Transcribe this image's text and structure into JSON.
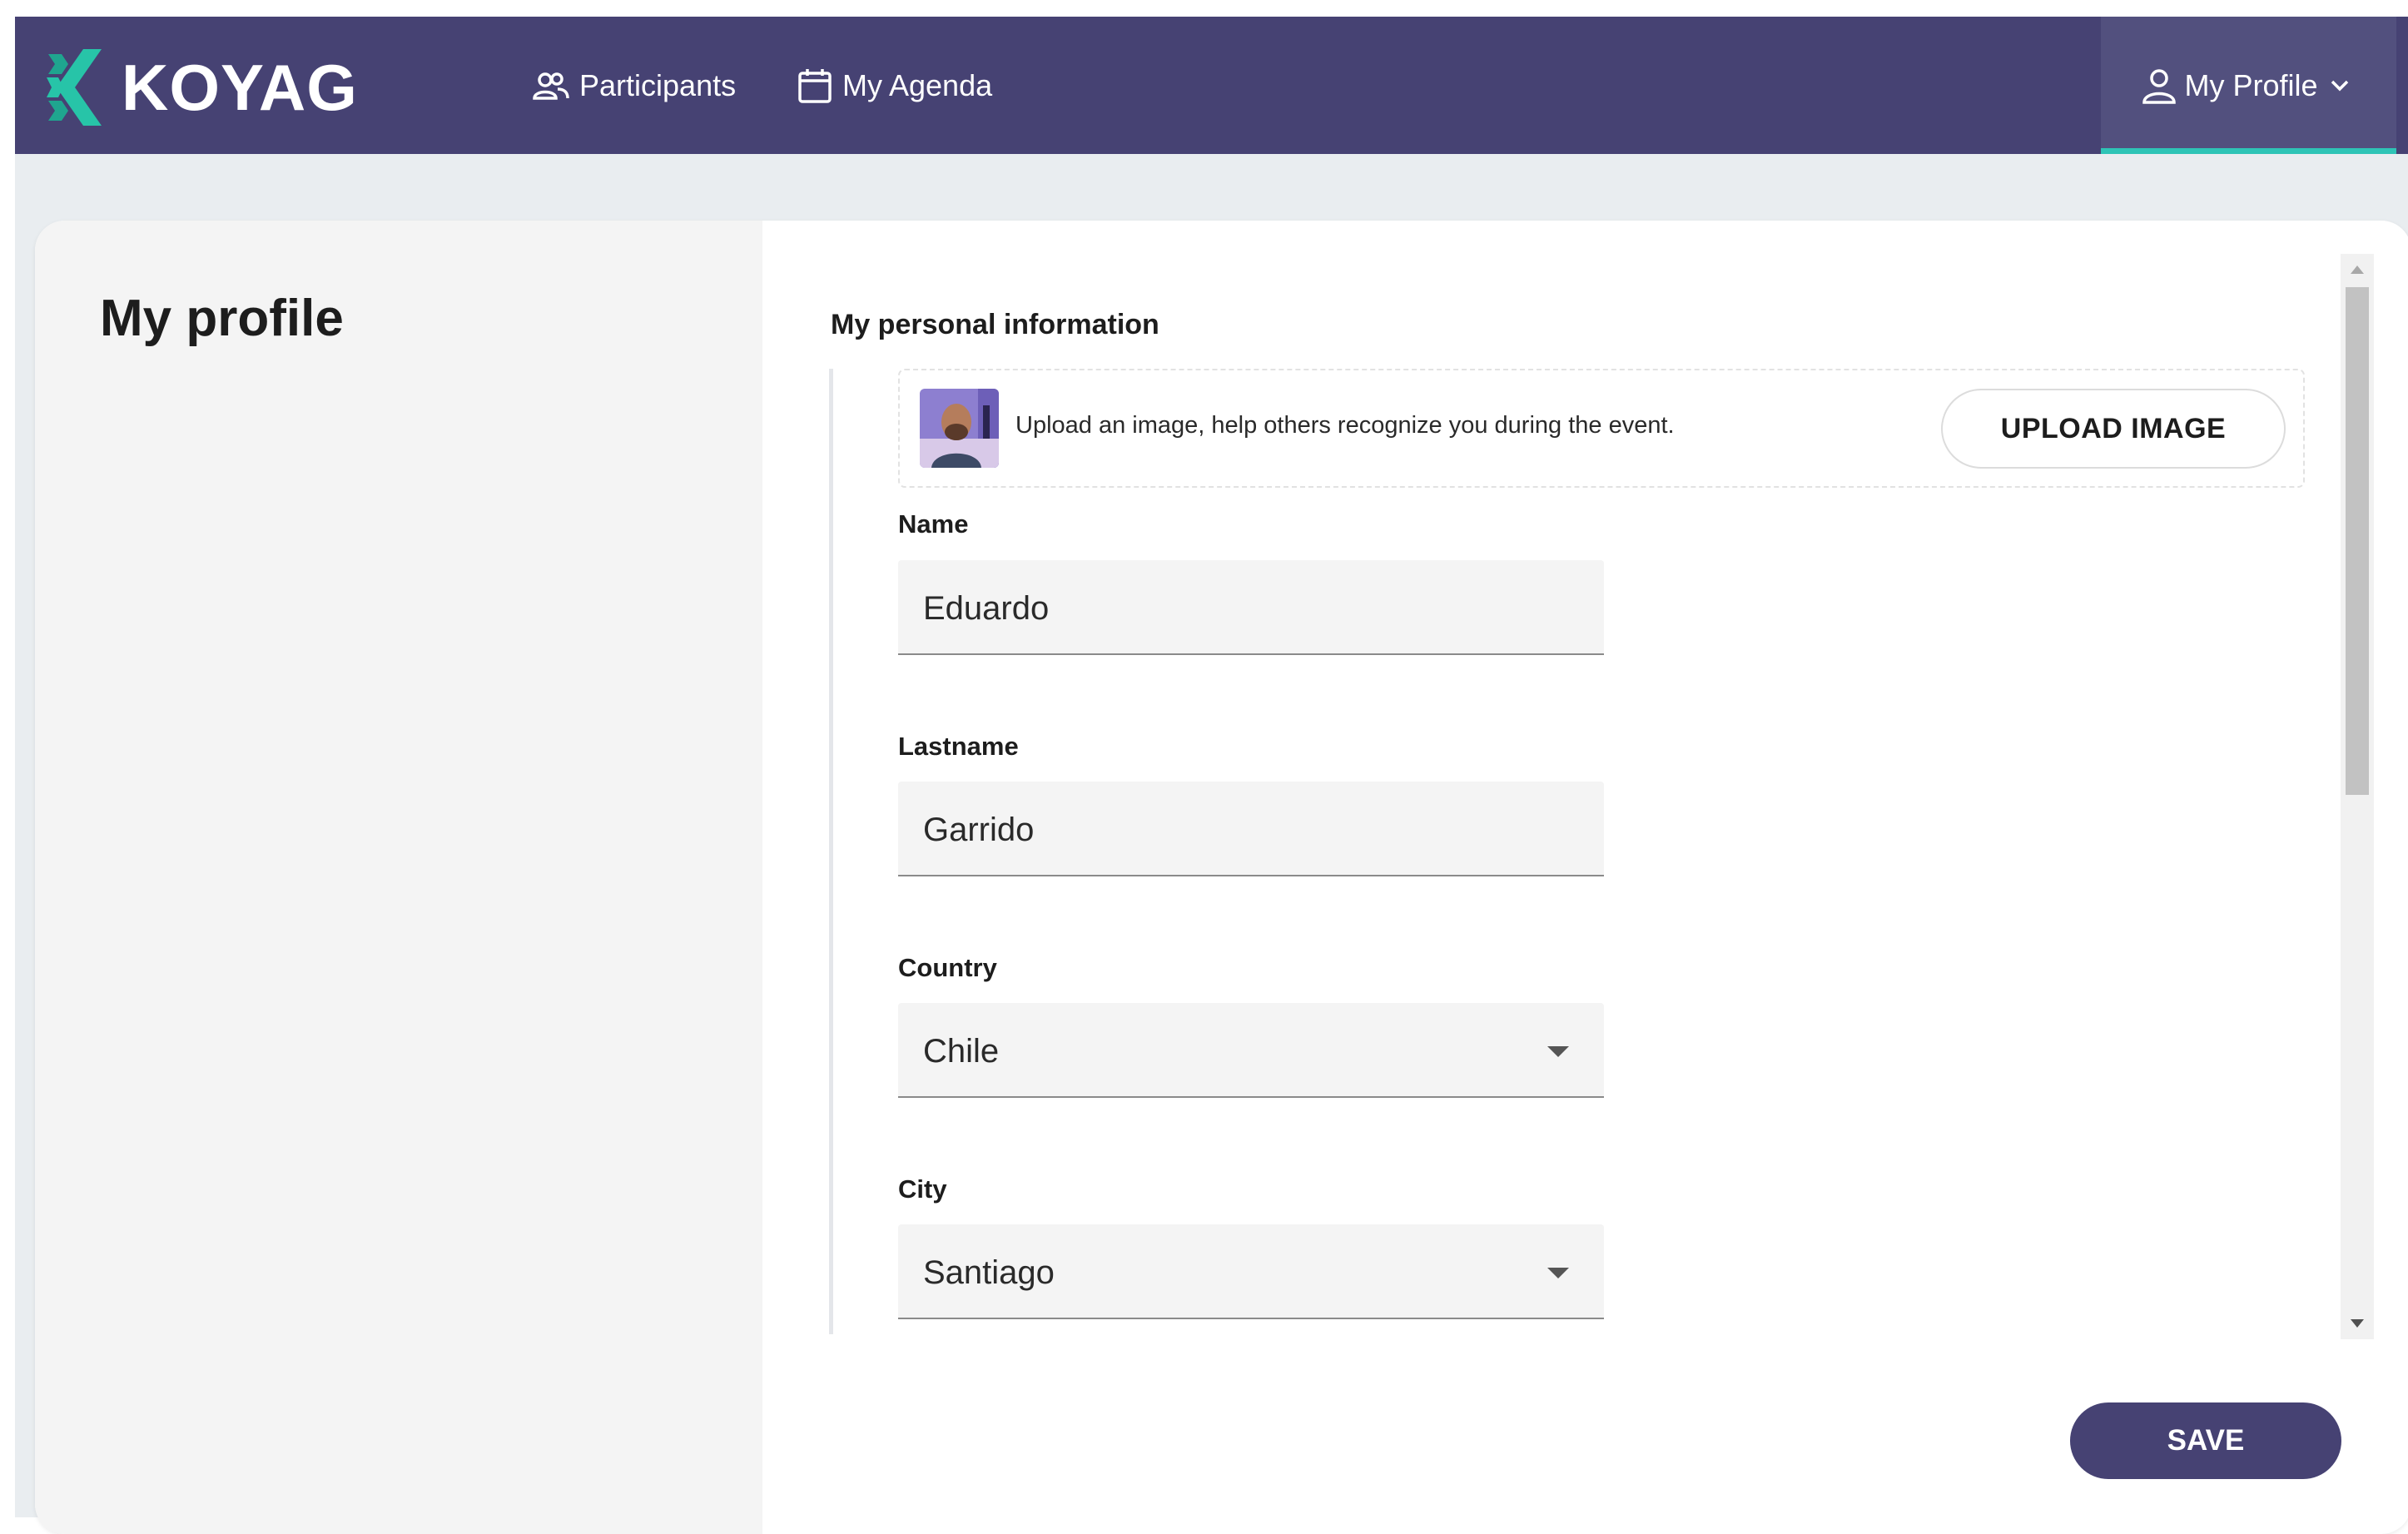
{
  "header": {
    "logo_text": "KOYAG",
    "nav": {
      "participants_label": "Participants",
      "agenda_label": "My Agenda",
      "profile_label": "My Profile"
    },
    "icons": [
      "participants-icon",
      "calendar-icon",
      "person-icon",
      "chevron-down-icon"
    ]
  },
  "sidebar": {
    "title": "My profile"
  },
  "form": {
    "section_title": "My personal information",
    "upload": {
      "text": "Upload an image, help others recognize you during the event.",
      "button_label": "UPLOAD IMAGE"
    },
    "fields": [
      {
        "label": "Name",
        "value": "Eduardo",
        "type": "text"
      },
      {
        "label": "Lastname",
        "value": "Garrido",
        "type": "text"
      },
      {
        "label": "Country",
        "value": "Chile",
        "type": "select"
      },
      {
        "label": "City",
        "value": "Santiago",
        "type": "select"
      }
    ],
    "save_label": "SAVE"
  },
  "colors": {
    "nav_bg": "#464273",
    "accent": "#2ec4b6",
    "save_bg": "#464273"
  }
}
